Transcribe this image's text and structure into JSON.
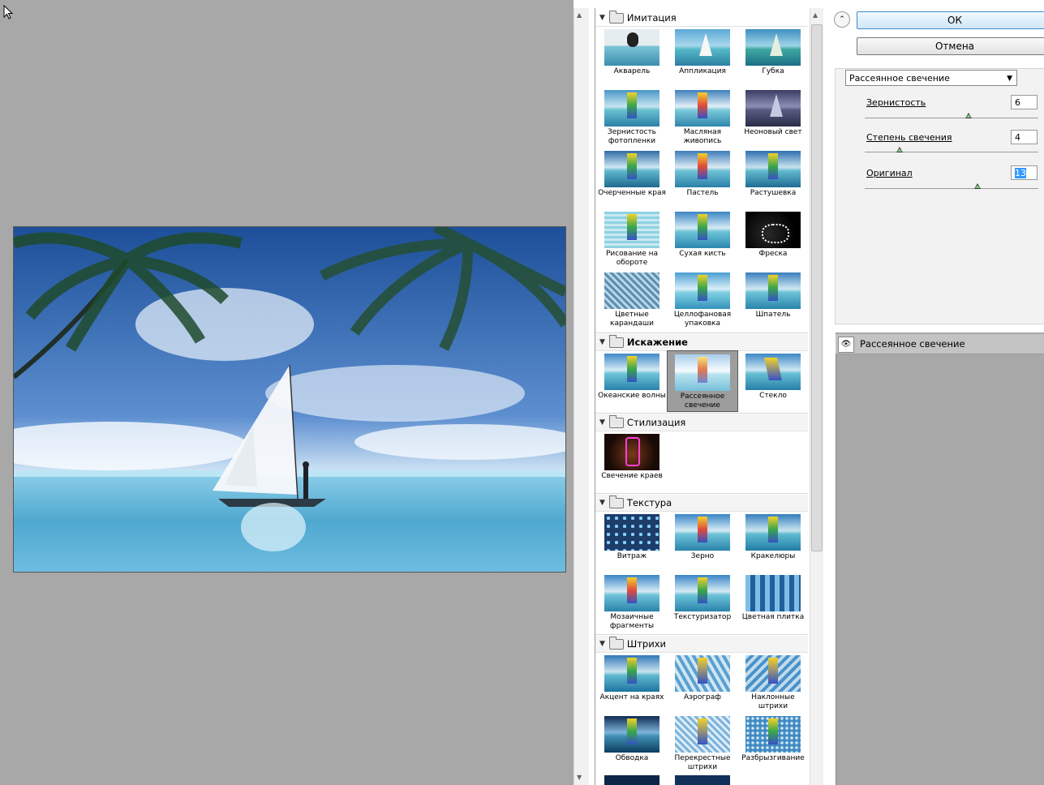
{
  "gallery": {
    "categories": [
      {
        "name": "Имитация",
        "filters": [
          "Акварель",
          "Аппликация",
          "Губка",
          "Зернистость фотопленки",
          "Масляная живопись",
          "Неоновый свет",
          "Очерченные края",
          "Пастель",
          "Растушевка",
          "Рисование на обороте",
          "Сухая кисть",
          "Фреска",
          "Цветные карандаши",
          "Целлофановая упаковка",
          "Шпатель"
        ]
      },
      {
        "name": "Искажение",
        "filters": [
          "Океанские волны",
          "Рассеянное свечение",
          "Стекло"
        ]
      },
      {
        "name": "Стилизация",
        "filters": [
          "Свечение краев"
        ]
      },
      {
        "name": "Текстура",
        "filters": [
          "Витраж",
          "Зерно",
          "Кракелюры",
          "Мозаичные фрагменты",
          "Текстуризатор",
          "Цветная плитка"
        ]
      },
      {
        "name": "Штрихи",
        "filters": [
          "Акцент на краях",
          "Аэрограф",
          "Наклонные штрихи",
          "Обводка",
          "Перекрестные штрихи",
          "Разбрызгивание"
        ]
      }
    ],
    "selected": "Рассеянное свечение"
  },
  "settings": {
    "ok_label": "ОК",
    "cancel_label": "Отмена",
    "filter_select": "Рассеянное свечение",
    "params": [
      {
        "label": "Зернистость",
        "value": "6",
        "level": 0.6
      },
      {
        "label": "Степень свечения",
        "value": "4",
        "level": 0.2
      },
      {
        "label": "Оригинал",
        "value": "13",
        "level": 0.65
      }
    ]
  },
  "layers": {
    "items": [
      {
        "name": "Рассеянное свечение",
        "visible": true
      }
    ]
  }
}
